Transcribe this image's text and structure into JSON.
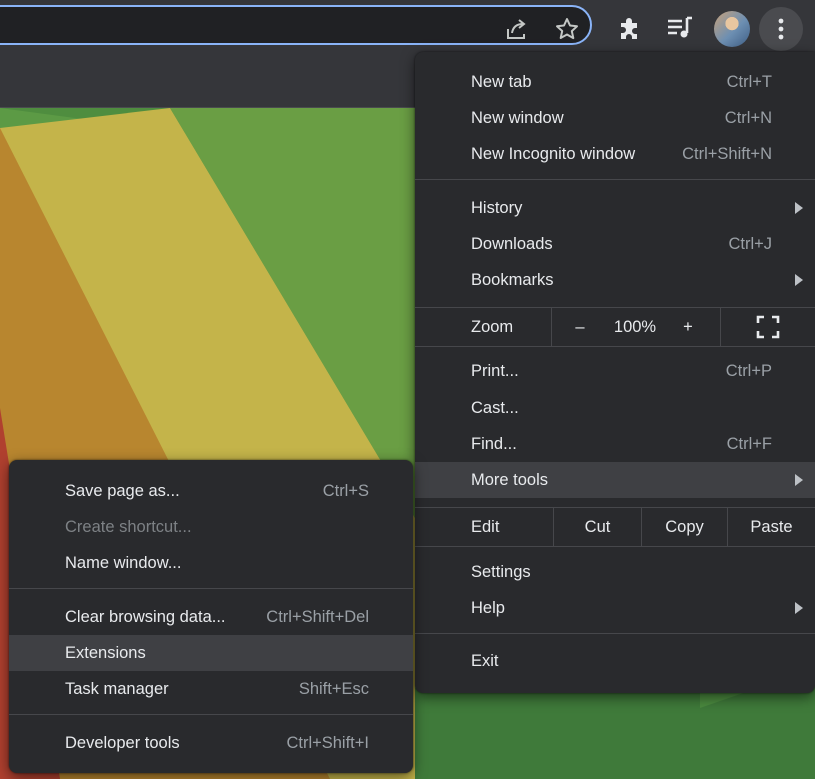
{
  "toolbar": {
    "icons": [
      "share-icon",
      "bookmark-star-icon",
      "extensions-puzzle-icon",
      "media-queue-icon",
      "profile-avatar",
      "kebab-menu-icon"
    ]
  },
  "main_menu": {
    "new_tab": {
      "label": "New tab",
      "shortcut": "Ctrl+T"
    },
    "new_window": {
      "label": "New window",
      "shortcut": "Ctrl+N"
    },
    "new_incognito": {
      "label": "New Incognito window",
      "shortcut": "Ctrl+Shift+N"
    },
    "history": {
      "label": "History"
    },
    "downloads": {
      "label": "Downloads",
      "shortcut": "Ctrl+J"
    },
    "bookmarks": {
      "label": "Bookmarks"
    },
    "zoom": {
      "label": "Zoom",
      "minus": "–",
      "value": "100%",
      "plus": "+"
    },
    "print": {
      "label": "Print...",
      "shortcut": "Ctrl+P"
    },
    "cast": {
      "label": "Cast..."
    },
    "find": {
      "label": "Find...",
      "shortcut": "Ctrl+F"
    },
    "more_tools": {
      "label": "More tools"
    },
    "edit": {
      "label": "Edit",
      "cut": "Cut",
      "copy": "Copy",
      "paste": "Paste"
    },
    "settings": {
      "label": "Settings"
    },
    "help": {
      "label": "Help"
    },
    "exit": {
      "label": "Exit"
    }
  },
  "sub_menu": {
    "save_page": {
      "label": "Save page as...",
      "shortcut": "Ctrl+S"
    },
    "create_shortcut": {
      "label": "Create shortcut..."
    },
    "name_window": {
      "label": "Name window..."
    },
    "clear_data": {
      "label": "Clear browsing data...",
      "shortcut": "Ctrl+Shift+Del"
    },
    "extensions": {
      "label": "Extensions"
    },
    "task_manager": {
      "label": "Task manager",
      "shortcut": "Shift+Esc"
    },
    "dev_tools": {
      "label": "Developer tools",
      "shortcut": "Ctrl+Shift+I"
    }
  },
  "colors": {
    "menu_bg": "#292a2d",
    "highlight": "#3f4044",
    "text": "#e8eaed",
    "shortcut": "#9aa0a6",
    "omnibox_border": "#8ab4f8"
  }
}
